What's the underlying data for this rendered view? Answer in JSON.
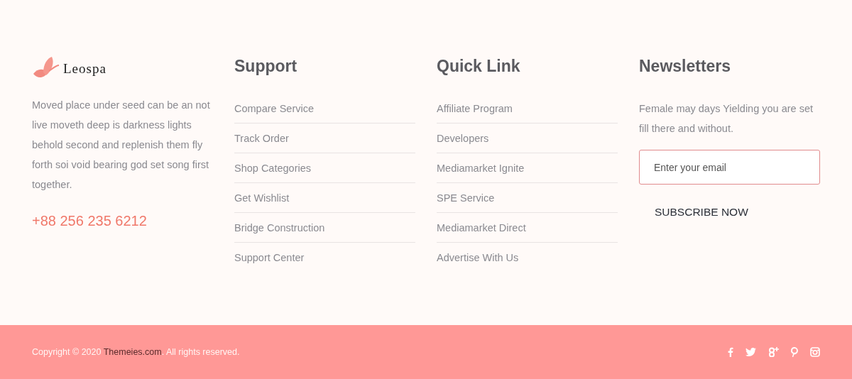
{
  "brand": {
    "name": "Leospa",
    "description": "Moved place under seed can be an not live moveth deep is darkness lights behold second and replenish them fly forth soi void bearing god set song first together.",
    "phone": "+88 256 235 6212"
  },
  "columns": [
    {
      "title": "Support",
      "links": [
        "Compare Service",
        "Track Order",
        "Shop Categories",
        "Get Wishlist",
        "Bridge Construction",
        "Support Center"
      ]
    },
    {
      "title": "Quick Link",
      "links": [
        "Affiliate Program",
        "Developers",
        "Mediamarket Ignite",
        "SPE Service",
        "Mediamarket Direct",
        "Advertise With Us"
      ]
    }
  ],
  "newsletter": {
    "title": "Newsletters",
    "text": "Female may days Yielding you are set fill there and without.",
    "placeholder": "Enter your email",
    "button": "SUBSCRIBE NOW"
  },
  "footer": {
    "copyright_before": "Copyright © 2020 ",
    "copyright_link": "Themeies.com",
    "copyright_after": ". All rights reserved."
  }
}
